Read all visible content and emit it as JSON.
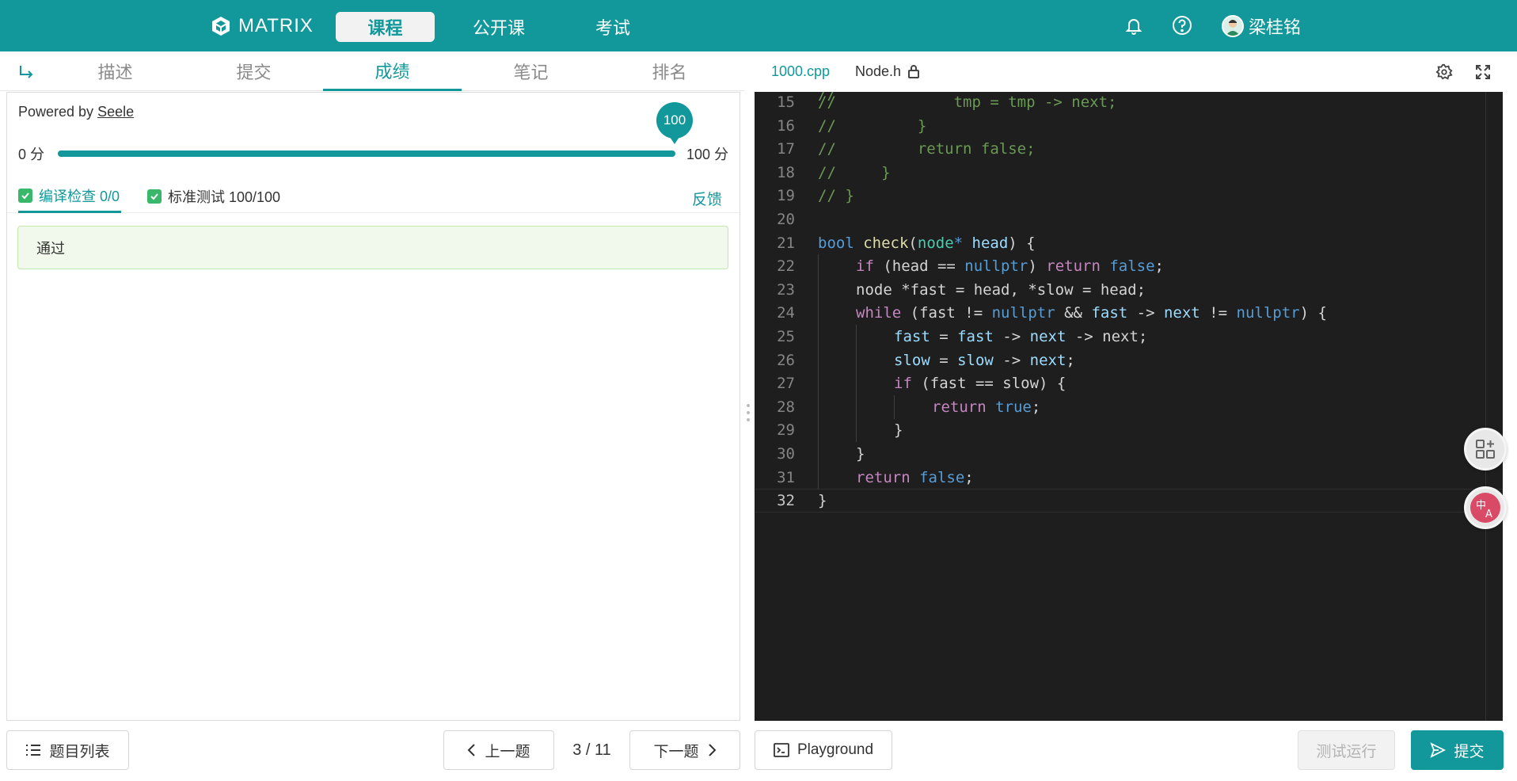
{
  "topbar": {
    "logo_text": "MATRIX",
    "nav": [
      {
        "label": "课程",
        "active": true
      },
      {
        "label": "公开课",
        "active": false
      },
      {
        "label": "考试",
        "active": false
      }
    ],
    "user_name": "梁桂铭",
    "icons": [
      "bell-icon",
      "help-icon"
    ],
    "accent_color": "#12989a"
  },
  "left": {
    "tabs": [
      {
        "label": "描述"
      },
      {
        "label": "提交"
      },
      {
        "label": "成绩",
        "active": true
      },
      {
        "label": "笔记"
      },
      {
        "label": "排名"
      }
    ],
    "powered_prefix": "Powered by ",
    "powered_link": "Seele",
    "score": {
      "min_label": "0 分",
      "max_label": "100 分",
      "value_label": "100",
      "value": 100,
      "max": 100
    },
    "check_tabs": [
      {
        "label": "编译检查 0/0",
        "active": true
      },
      {
        "label": "标准测试 100/100",
        "active": false
      }
    ],
    "feedback_label": "反馈",
    "result_text": "通过"
  },
  "editor": {
    "files": [
      {
        "label": "1000.cpp",
        "active": true
      },
      {
        "label": "Node.h",
        "locked": true
      }
    ],
    "lines": [
      {
        "n": "15",
        "indent": 0,
        "tokens": [
          {
            "t": "//             tmp = tmp -> next;",
            "c": "c-com"
          }
        ]
      },
      {
        "n": "16",
        "indent": 0,
        "tokens": [
          {
            "t": "//         }",
            "c": "c-com"
          }
        ]
      },
      {
        "n": "17",
        "indent": 0,
        "tokens": [
          {
            "t": "//         return false;",
            "c": "c-com"
          }
        ]
      },
      {
        "n": "18",
        "indent": 0,
        "tokens": [
          {
            "t": "//     }",
            "c": "c-com"
          }
        ]
      },
      {
        "n": "19",
        "indent": 0,
        "tokens": [
          {
            "t": "// }",
            "c": "c-com"
          }
        ]
      },
      {
        "n": "20",
        "indent": 0,
        "tokens": []
      },
      {
        "n": "21",
        "indent": 0,
        "tokens": [
          {
            "t": "bool",
            "c": "c-kw"
          },
          {
            "t": " ",
            "c": "c-txt"
          },
          {
            "t": "check",
            "c": "c-fn"
          },
          {
            "t": "(",
            "c": "c-txt"
          },
          {
            "t": "node",
            "c": "c-ty"
          },
          {
            "t": "* ",
            "c": "c-kw"
          },
          {
            "t": "head",
            "c": "c-var"
          },
          {
            "t": ") {",
            "c": "c-txt"
          }
        ]
      },
      {
        "n": "22",
        "indent": 1,
        "tokens": [
          {
            "t": "if",
            "c": "c-ctl"
          },
          {
            "t": " (head == ",
            "c": "c-txt"
          },
          {
            "t": "nullptr",
            "c": "c-kw"
          },
          {
            "t": ") ",
            "c": "c-txt"
          },
          {
            "t": "return",
            "c": "c-ctl"
          },
          {
            "t": " ",
            "c": "c-txt"
          },
          {
            "t": "false",
            "c": "c-kw"
          },
          {
            "t": ";",
            "c": "c-txt"
          }
        ]
      },
      {
        "n": "23",
        "indent": 1,
        "tokens": [
          {
            "t": "node *fast = head, *slow = head;",
            "c": "c-txt"
          }
        ]
      },
      {
        "n": "24",
        "indent": 1,
        "tokens": [
          {
            "t": "while",
            "c": "c-ctl"
          },
          {
            "t": " (fast != ",
            "c": "c-txt"
          },
          {
            "t": "nullptr",
            "c": "c-kw"
          },
          {
            "t": " && ",
            "c": "c-txt"
          },
          {
            "t": "fast",
            "c": "c-var"
          },
          {
            "t": " -> ",
            "c": "c-txt"
          },
          {
            "t": "next",
            "c": "c-var"
          },
          {
            "t": " != ",
            "c": "c-txt"
          },
          {
            "t": "nullptr",
            "c": "c-kw"
          },
          {
            "t": ") {",
            "c": "c-txt"
          }
        ]
      },
      {
        "n": "25",
        "indent": 2,
        "tokens": [
          {
            "t": "fast",
            "c": "c-var"
          },
          {
            "t": " = ",
            "c": "c-txt"
          },
          {
            "t": "fast",
            "c": "c-var"
          },
          {
            "t": " -> ",
            "c": "c-txt"
          },
          {
            "t": "next",
            "c": "c-var"
          },
          {
            "t": " -> next;",
            "c": "c-txt"
          }
        ]
      },
      {
        "n": "26",
        "indent": 2,
        "tokens": [
          {
            "t": "slow",
            "c": "c-var"
          },
          {
            "t": " = ",
            "c": "c-txt"
          },
          {
            "t": "slow",
            "c": "c-var"
          },
          {
            "t": " -> ",
            "c": "c-txt"
          },
          {
            "t": "next",
            "c": "c-var"
          },
          {
            "t": ";",
            "c": "c-txt"
          }
        ]
      },
      {
        "n": "27",
        "indent": 2,
        "tokens": [
          {
            "t": "if",
            "c": "c-ctl"
          },
          {
            "t": " (fast == slow) {",
            "c": "c-txt"
          }
        ]
      },
      {
        "n": "28",
        "indent": 3,
        "tokens": [
          {
            "t": "return",
            "c": "c-ctl"
          },
          {
            "t": " ",
            "c": "c-txt"
          },
          {
            "t": "true",
            "c": "c-kw"
          },
          {
            "t": ";",
            "c": "c-txt"
          }
        ]
      },
      {
        "n": "29",
        "indent": 2,
        "tokens": [
          {
            "t": "}",
            "c": "c-txt"
          }
        ]
      },
      {
        "n": "30",
        "indent": 1,
        "tokens": [
          {
            "t": "}",
            "c": "c-txt"
          }
        ]
      },
      {
        "n": "31",
        "indent": 1,
        "tokens": [
          {
            "t": "return",
            "c": "c-ctl"
          },
          {
            "t": " ",
            "c": "c-txt"
          },
          {
            "t": "false",
            "c": "c-kw"
          },
          {
            "t": ";",
            "c": "c-txt"
          }
        ]
      },
      {
        "n": "32",
        "indent": 0,
        "current": true,
        "tokens": [
          {
            "t": "}",
            "c": "c-txt"
          }
        ]
      }
    ]
  },
  "bottom": {
    "problem_list_label": "题目列表",
    "prev_label": "上一题",
    "page": "3 / 11",
    "next_label": "下一题",
    "playground_label": "Playground",
    "test_run_label": "测试运行",
    "submit_label": "提交"
  }
}
